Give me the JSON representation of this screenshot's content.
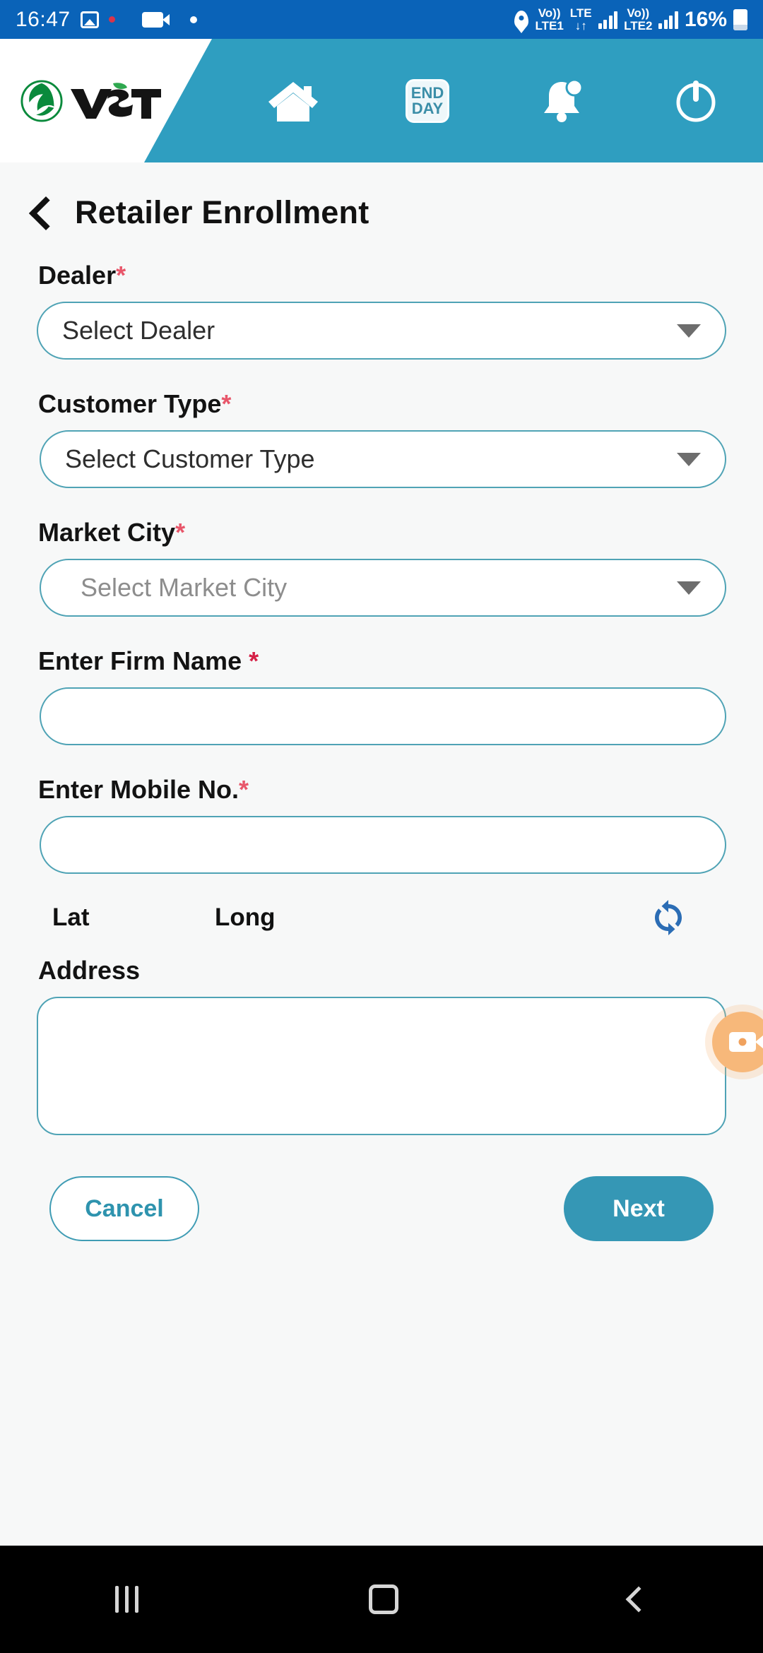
{
  "status_bar": {
    "clock": "16:47",
    "battery_percent": "16%",
    "sim1_label": "Vo)) LTE1",
    "sim1_top": "Vo))",
    "sim1_bottom": "LTE1",
    "lte_label": "LTE",
    "data_arrows": "↓↑",
    "sim2_top": "Vo))",
    "sim2_bottom": "LTE2",
    "icons": [
      "photo-icon",
      "record-dot-icon",
      "video-camera-icon",
      "dot-icon",
      "location-pin-icon",
      "signal-bars-icon",
      "battery-icon"
    ]
  },
  "app_header": {
    "brand_name": "VST",
    "home_label": "Home",
    "end_day_line1": "END",
    "end_day_line2": "DAY",
    "notification_label": "Notifications",
    "power_label": "Logout",
    "accent_color": "#2f9ec0"
  },
  "page": {
    "title": "Retailer Enrollment",
    "back_label": "Back"
  },
  "form": {
    "fields": [
      {
        "key": "dealer",
        "label": "Dealer",
        "required": true,
        "required_mark": "*",
        "type": "select",
        "value": "Select Dealer",
        "is_placeholder": false
      },
      {
        "key": "customer_type",
        "label": "Customer Type",
        "required": true,
        "required_mark": "*",
        "type": "select",
        "value": "Select Customer Type",
        "is_placeholder": false
      },
      {
        "key": "market_city",
        "label": "Market City",
        "required": true,
        "required_mark": "*",
        "type": "select",
        "value": "Select Market City",
        "is_placeholder": true
      },
      {
        "key": "firm_name",
        "label": "Enter Firm Name ",
        "required": true,
        "required_mark": "*",
        "type": "text",
        "value": "",
        "is_placeholder": false
      },
      {
        "key": "mobile_no",
        "label": "Enter Mobile No.",
        "required": true,
        "required_mark": "*",
        "type": "text",
        "value": "",
        "is_placeholder": false
      }
    ],
    "geo": {
      "lat_label": "Lat",
      "lat_value": "",
      "long_label": "Long",
      "long_value": "",
      "refresh_label": "refresh-location"
    },
    "address": {
      "label": "Address",
      "value": "",
      "required": false
    }
  },
  "actions": {
    "cancel_label": "Cancel",
    "next_label": "Next",
    "cancel_color": "#2e93ae",
    "next_bg": "#3597b5"
  },
  "floating": {
    "recorder_label": "screen-recorder",
    "color": "#f7b87a"
  },
  "nav_bar": {
    "recent_label": "Recents",
    "home_label": "Home",
    "back_label": "Back"
  }
}
